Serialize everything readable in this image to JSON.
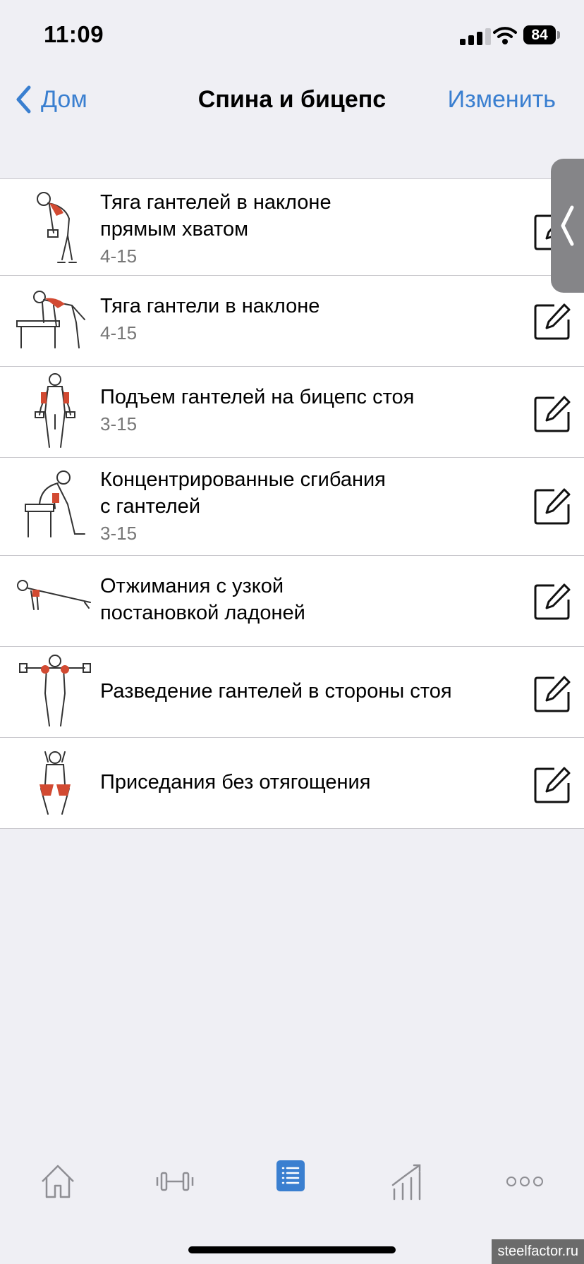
{
  "status_bar": {
    "time": "11:09",
    "battery": "84"
  },
  "nav": {
    "back_label": "Дом",
    "title": "Спина и бицепс",
    "edit_label": "Изменить"
  },
  "exercises": [
    {
      "name": "Тяга гантелей в наклоне\nпрямым хватом",
      "sets": "4-15"
    },
    {
      "name": "Тяга гантели в наклоне",
      "sets": "4-15"
    },
    {
      "name": "Подъем гантелей на бицепс стоя",
      "sets": "3-15"
    },
    {
      "name": "Концентрированные сгибания\nс гантелей",
      "sets": "3-15"
    },
    {
      "name": "Отжимания с узкой\nпостановкой ладоней",
      "sets": ""
    },
    {
      "name": "Разведение гантелей в стороны стоя",
      "sets": ""
    },
    {
      "name": "Приседания без отягощения",
      "sets": ""
    }
  ],
  "tabs": [
    {
      "icon": "house-icon"
    },
    {
      "icon": "dumbbell-icon"
    },
    {
      "icon": "list-icon",
      "active": true
    },
    {
      "icon": "chart-icon"
    },
    {
      "icon": "more-icon"
    }
  ],
  "colors": {
    "accent": "#3a7fd0",
    "muscle": "#d24a32"
  },
  "watermark": "steelfactor.ru"
}
